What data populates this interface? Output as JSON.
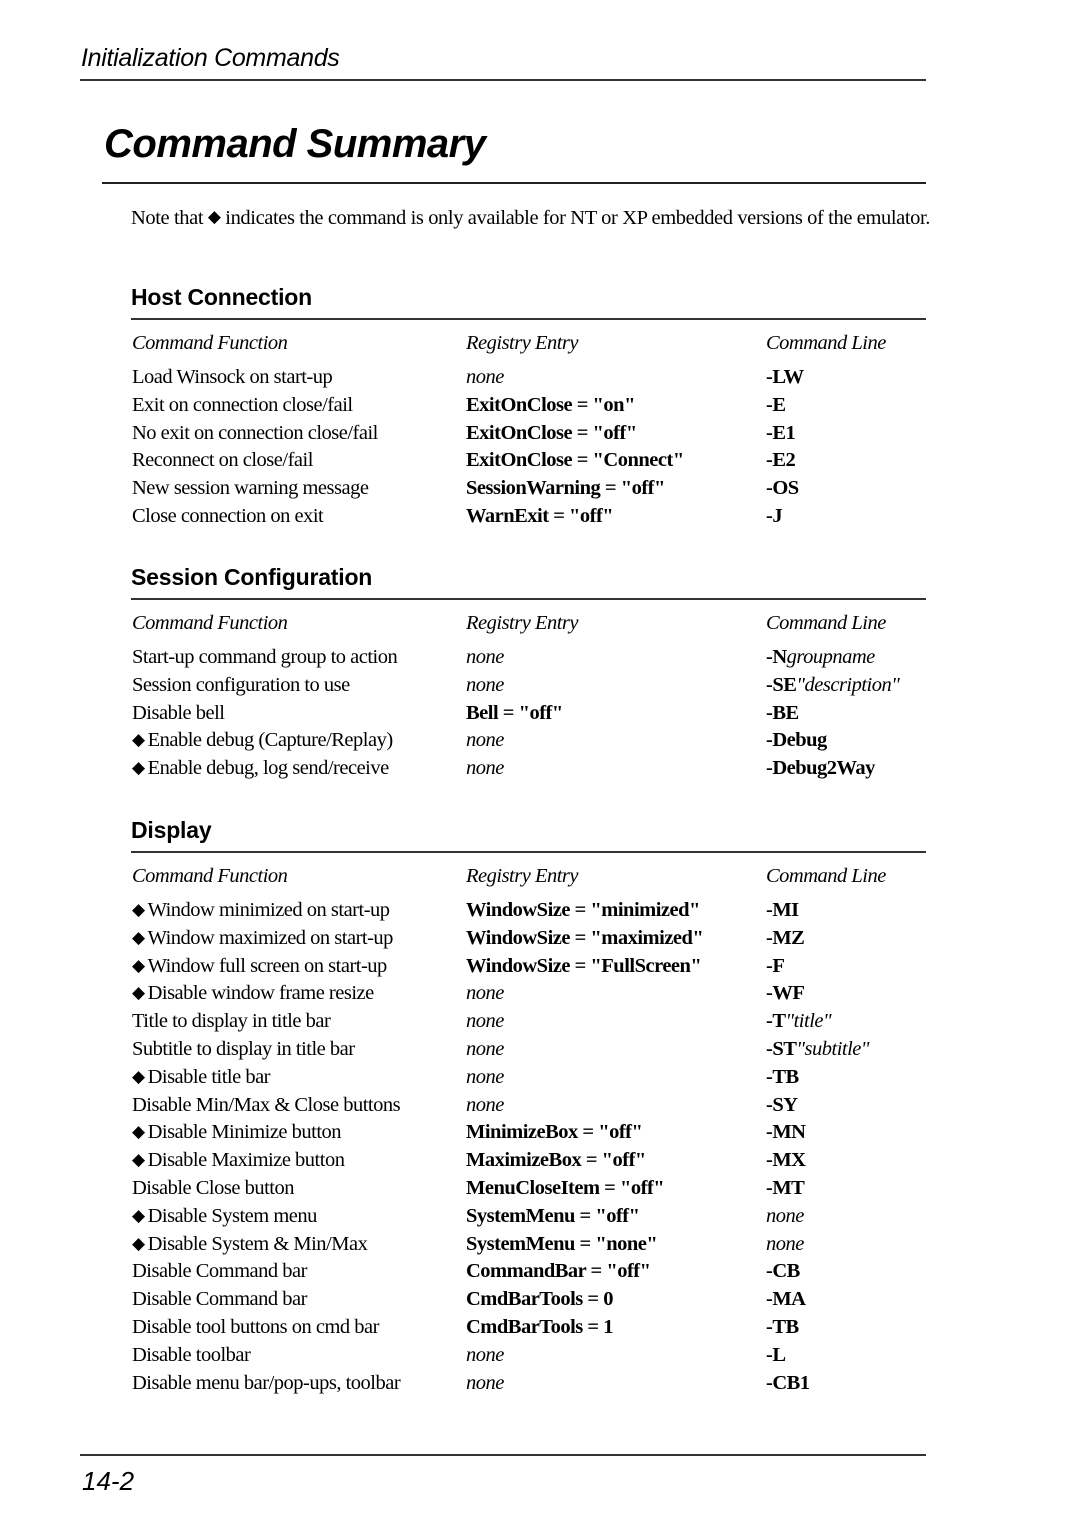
{
  "header": {
    "running_head": "Initialization Commands",
    "title": "Command Summary"
  },
  "note": {
    "prefix": "Note that",
    "symbol": "◆",
    "suffix": "indicates the command is only available for NT or XP embedded versions of the emulator."
  },
  "columns": {
    "function": "Command Function",
    "registry": "Registry Entry",
    "command_line": "Command Line"
  },
  "sections": [
    {
      "title": "Host Connection",
      "rows": [
        {
          "nt_only": false,
          "function": "Load Winsock on start-up",
          "registry": "none",
          "registry_style": "italic",
          "cmd": "-LW",
          "cmd_arg": "",
          "cmd_style": "bold"
        },
        {
          "nt_only": false,
          "function": "Exit on connection close/fail",
          "registry": "ExitOnClose = \"on\"",
          "registry_style": "bold",
          "cmd": "-E",
          "cmd_arg": "",
          "cmd_style": "bold"
        },
        {
          "nt_only": false,
          "function": "No exit on connection close/fail",
          "registry": "ExitOnClose = \"off\"",
          "registry_style": "bold",
          "cmd": "-E1",
          "cmd_arg": "",
          "cmd_style": "bold"
        },
        {
          "nt_only": false,
          "function": "Reconnect on close/fail",
          "registry": "ExitOnClose = \"Connect\"",
          "registry_style": "bold",
          "cmd": "-E2",
          "cmd_arg": "",
          "cmd_style": "bold"
        },
        {
          "nt_only": false,
          "function": "New session warning message",
          "registry": "SessionWarning = \"off\"",
          "registry_style": "bold",
          "cmd": "-OS",
          "cmd_arg": "",
          "cmd_style": "bold"
        },
        {
          "nt_only": false,
          "function": "Close connection on exit",
          "registry": "WarnExit = \"off\"",
          "registry_style": "bold",
          "cmd": "-J",
          "cmd_arg": "",
          "cmd_style": "bold"
        }
      ]
    },
    {
      "title": "Session Configuration",
      "rows": [
        {
          "nt_only": false,
          "function": "Start-up command group to action",
          "registry": "none",
          "registry_style": "italic",
          "cmd": "-N",
          "cmd_arg": "groupname",
          "cmd_style": "bold"
        },
        {
          "nt_only": false,
          "function": "Session configuration to use",
          "registry": "none",
          "registry_style": "italic",
          "cmd": "-SE",
          "cmd_arg": "\"description\"",
          "cmd_style": "bold"
        },
        {
          "nt_only": false,
          "function": "Disable bell",
          "registry": "Bell = \"off\"",
          "registry_style": "bold",
          "cmd": "-BE",
          "cmd_arg": "",
          "cmd_style": "bold"
        },
        {
          "nt_only": true,
          "function": "Enable debug (Capture/Replay)",
          "registry": "none",
          "registry_style": "italic",
          "cmd": "-Debug",
          "cmd_arg": "",
          "cmd_style": "bold"
        },
        {
          "nt_only": true,
          "function": "Enable debug, log send/receive",
          "registry": "none",
          "registry_style": "italic",
          "cmd": "-Debug2Way",
          "cmd_arg": "",
          "cmd_style": "bold"
        }
      ]
    },
    {
      "title": "Display",
      "rows": [
        {
          "nt_only": true,
          "function": "Window minimized on start-up",
          "registry": "WindowSize = \"minimized\"",
          "registry_style": "bold",
          "cmd": "-MI",
          "cmd_arg": "",
          "cmd_style": "bold"
        },
        {
          "nt_only": true,
          "function": "Window maximized on start-up",
          "registry": "WindowSize = \"maximized\"",
          "registry_style": "bold",
          "cmd": "-MZ",
          "cmd_arg": "",
          "cmd_style": "bold"
        },
        {
          "nt_only": true,
          "function": "Window full screen on start-up",
          "registry": "WindowSize = \"FullScreen\"",
          "registry_style": "bold",
          "cmd": "-F",
          "cmd_arg": "",
          "cmd_style": "bold"
        },
        {
          "nt_only": true,
          "function": "Disable window frame resize",
          "registry": "none",
          "registry_style": "italic",
          "cmd": "-WF",
          "cmd_arg": "",
          "cmd_style": "bold"
        },
        {
          "nt_only": false,
          "function": "Title to display in title bar",
          "registry": "none",
          "registry_style": "italic",
          "cmd": "-T",
          "cmd_arg": "\"title\"",
          "cmd_style": "bold"
        },
        {
          "nt_only": false,
          "function": "Subtitle to display in title bar",
          "registry": "none",
          "registry_style": "italic",
          "cmd": "-ST",
          "cmd_arg": "\"subtitle\"",
          "cmd_style": "bold"
        },
        {
          "nt_only": true,
          "function": "Disable title bar",
          "registry": "none",
          "registry_style": "italic",
          "cmd": "-TB",
          "cmd_arg": "",
          "cmd_style": "bold"
        },
        {
          "nt_only": false,
          "function": "Disable Min/Max & Close buttons",
          "registry": "none",
          "registry_style": "italic",
          "cmd": "-SY",
          "cmd_arg": "",
          "cmd_style": "bold"
        },
        {
          "nt_only": true,
          "function": "Disable Minimize button",
          "registry": "MinimizeBox = \"off\"",
          "registry_style": "bold",
          "cmd": "-MN",
          "cmd_arg": "",
          "cmd_style": "bold"
        },
        {
          "nt_only": true,
          "function": "Disable Maximize button",
          "registry": "MaximizeBox = \"off\"",
          "registry_style": "bold",
          "cmd": "-MX",
          "cmd_arg": "",
          "cmd_style": "bold"
        },
        {
          "nt_only": false,
          "function": "Disable Close button",
          "registry": "MenuCloseItem = \"off\"",
          "registry_style": "bold",
          "cmd": "-MT",
          "cmd_arg": "",
          "cmd_style": "bold"
        },
        {
          "nt_only": true,
          "function": "Disable System menu",
          "registry": "SystemMenu = \"off\"",
          "registry_style": "bold",
          "cmd": "none",
          "cmd_arg": "",
          "cmd_style": "italic"
        },
        {
          "nt_only": true,
          "function": "Disable System & Min/Max",
          "registry": "SystemMenu = \"none\"",
          "registry_style": "bold",
          "cmd": "none",
          "cmd_arg": "",
          "cmd_style": "italic"
        },
        {
          "nt_only": false,
          "function": "Disable Command bar",
          "registry": "CommandBar = \"off\"",
          "registry_style": "bold",
          "cmd": "-CB",
          "cmd_arg": "",
          "cmd_style": "bold"
        },
        {
          "nt_only": false,
          "function": "Disable Command bar",
          "registry": "CmdBarTools = 0",
          "registry_style": "bold",
          "cmd": "-MA",
          "cmd_arg": "",
          "cmd_style": "bold"
        },
        {
          "nt_only": false,
          "function": "Disable tool buttons on cmd bar",
          "registry": "CmdBarTools = 1",
          "registry_style": "bold",
          "cmd": "-TB",
          "cmd_arg": "",
          "cmd_style": "bold"
        },
        {
          "nt_only": false,
          "function": "Disable toolbar",
          "registry": "none",
          "registry_style": "italic",
          "cmd": "-L",
          "cmd_arg": "",
          "cmd_style": "bold"
        },
        {
          "nt_only": false,
          "function": "Disable menu bar/pop-ups, toolbar",
          "registry": "none",
          "registry_style": "italic",
          "cmd": "-CB1",
          "cmd_arg": "",
          "cmd_style": "bold"
        }
      ]
    }
  ],
  "footer": {
    "page_number": "14-2"
  }
}
